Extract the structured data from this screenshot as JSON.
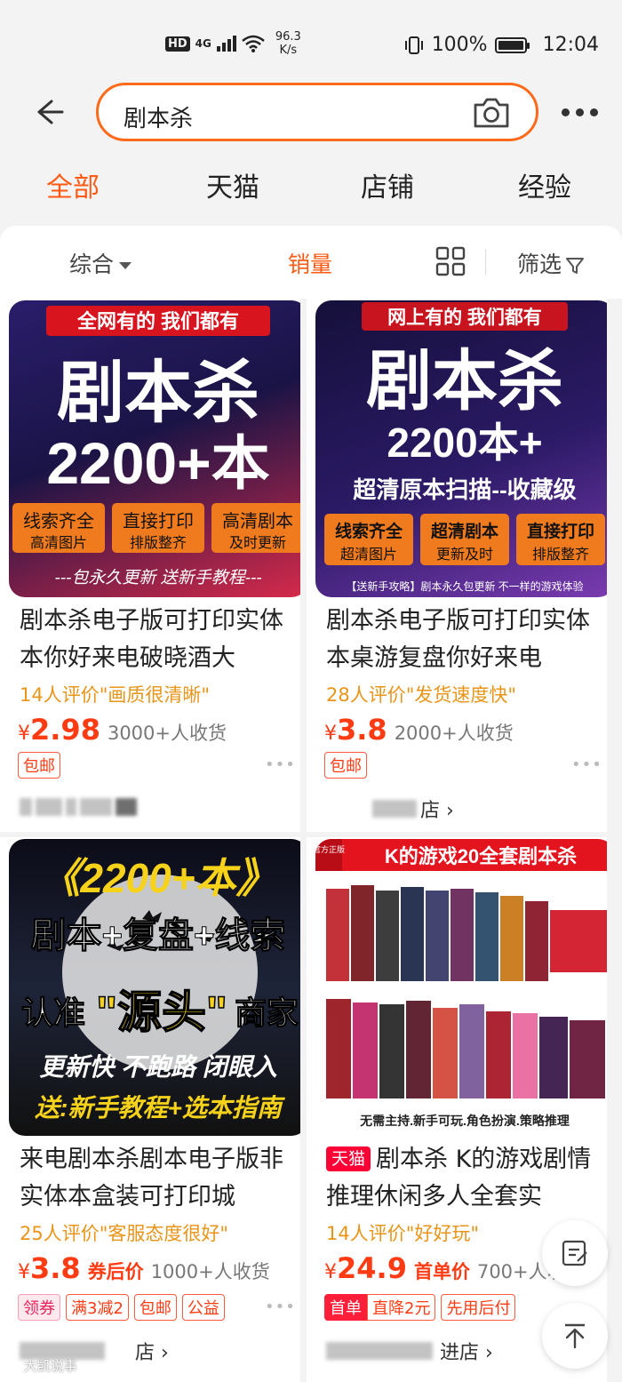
{
  "status": {
    "network": "4G",
    "speed": "96.3",
    "speed_unit": "K/s",
    "battery": "100%",
    "time": "12:04"
  },
  "search": {
    "query": "剧本杀"
  },
  "tabs": [
    "全部",
    "天猫",
    "店铺",
    "经验"
  ],
  "sort": {
    "comprehensive": "综合",
    "sales": "销量",
    "filter": "筛选"
  },
  "products": [
    {
      "thumb": {
        "banner": "全网有的 我们都有",
        "big": "剧本杀",
        "count": "2200+本",
        "chips": [
          [
            "线索齐全",
            "高清图片"
          ],
          [
            "直接打印",
            "排版整齐"
          ],
          [
            "高清剧本",
            "及时更新"
          ]
        ],
        "footer": "---包永久更新 送新手教程---"
      },
      "title": "剧本杀电子版可打印实体本你好来电破晓酒大",
      "review": "14人评价\"画质很清晰\"",
      "yen": "¥",
      "price": "2.98",
      "sold": "3000+人收货",
      "badges": [
        "包邮"
      ],
      "shop": ""
    },
    {
      "thumb": {
        "banner": "网上有的 我们都有",
        "big": "剧本杀",
        "count": "2200本+",
        "sub": "超清原本扫描--收藏级",
        "chips": [
          [
            "线索齐全",
            "超清图片"
          ],
          [
            "超清剧本",
            "更新及时"
          ],
          [
            "直接打印",
            "排版整齐"
          ]
        ],
        "footer": "【送新手攻略】剧本永久包更新 不一样的游戏体验"
      },
      "title": "剧本杀电子版可打印实体本桌游复盘你好来电",
      "review": "28人评价\"发货速度快\"",
      "yen": "¥",
      "price": "3.8",
      "sold": "2000+人收货",
      "badges": [
        "包邮"
      ],
      "shop": "店 ›"
    },
    {
      "thumb": {
        "l1": "《2200+本》",
        "l2": "剧本+复盘+线索",
        "l3a": "认准",
        "l3b": "\"源头\"",
        "l3c": "商家",
        "l4": "更新快 不跑路 闭眼入",
        "l5": "送:新手教程+选本指南"
      },
      "title": "来电剧本杀剧本电子版非实体本盒装可打印城",
      "review": "25人评价\"客服态度很好\"",
      "yen": "¥",
      "price": "3.8",
      "price_tag": "券后价",
      "sold": "1000+人收货",
      "badges": [
        "领券",
        "满3减2",
        "包邮",
        "公益"
      ],
      "shop": "店 ›"
    },
    {
      "thumb": {
        "corner": "官方正版",
        "header": "K的游戏20全套剧本杀",
        "caption": "无需主持.新手可玩.角色扮演.策略推理"
      },
      "tmall": "天猫",
      "title": "剧本杀 K的游戏剧情推理休闲多人全套实",
      "review": "14人评价\"好好玩\"",
      "yen": "¥",
      "price": "24.9",
      "price_tag": "首单价",
      "sold": "700+人收",
      "badges": [
        "首单",
        "直降2元",
        "先用后付"
      ],
      "shop": "进店 ›"
    }
  ],
  "watermark": "大凯说事",
  "colors": {
    "accent": "#ff5a14",
    "price": "#ff3b14",
    "review": "#e8951a"
  }
}
